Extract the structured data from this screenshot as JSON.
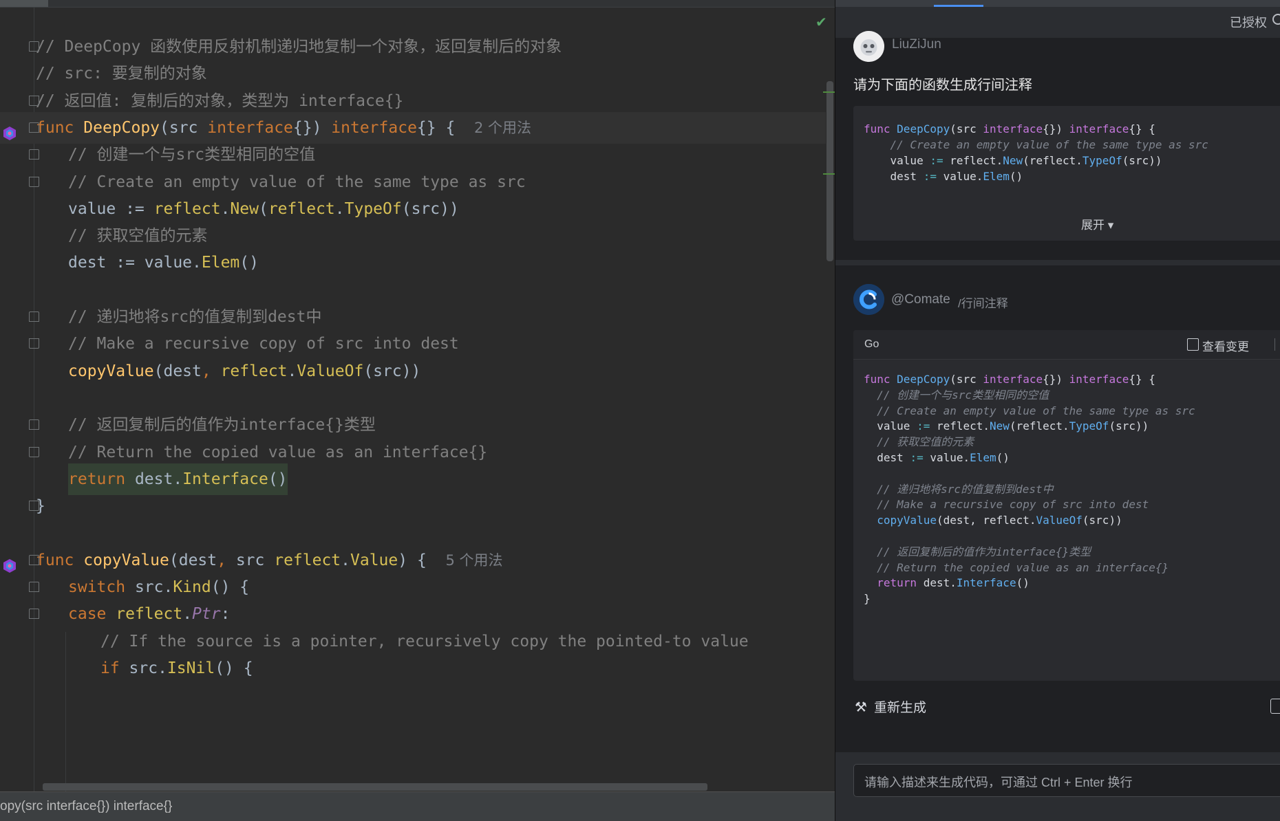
{
  "editor": {
    "usage_hints": [
      "2 个用法",
      "5 个用法"
    ],
    "lines": [
      {
        "parts": [
          [
            "c-cm",
            "// DeepCopy 函数使用反射机制递归地复制一个对象，返回复制后的对象"
          ]
        ]
      },
      {
        "parts": [
          [
            "c-cm",
            "// src: 要复制的对象"
          ]
        ]
      },
      {
        "parts": [
          [
            "c-cm",
            "// 返回值: 复制后的对象，类型为 interface{}"
          ]
        ]
      },
      {
        "parts": [
          [
            "c-kw",
            "func "
          ],
          [
            "c-fn",
            "DeepCopy"
          ],
          [
            "c-tx",
            "(src "
          ],
          [
            "c-kw",
            "interface"
          ],
          [
            "c-tx",
            "{}) "
          ],
          [
            "c-kw",
            "interface"
          ],
          [
            "c-tx",
            "{} {  "
          ]
        ],
        "hint": 0
      },
      {
        "parts": [
          [
            "c-cm",
            "// 创建一个与src类型相同的空值"
          ]
        ]
      },
      {
        "parts": [
          [
            "c-cm",
            "// Create an empty value of the same type as src"
          ]
        ]
      },
      {
        "parts": [
          [
            "c-tx",
            "value := "
          ],
          [
            "c-mt",
            "reflect"
          ],
          [
            "c-tx",
            "."
          ],
          [
            "c-mt",
            "New"
          ],
          [
            "c-tx",
            "("
          ],
          [
            "c-mt",
            "reflect"
          ],
          [
            "c-tx",
            "."
          ],
          [
            "c-mt",
            "TypeOf"
          ],
          [
            "c-tx",
            "(src))"
          ]
        ]
      },
      {
        "parts": [
          [
            "c-cm",
            "// 获取空值的元素"
          ]
        ]
      },
      {
        "parts": [
          [
            "c-tx",
            "dest := value."
          ],
          [
            "c-mt",
            "Elem"
          ],
          [
            "c-tx",
            "()"
          ]
        ]
      },
      {
        "parts": []
      },
      {
        "parts": [
          [
            "c-cm",
            "// 递归地将src的值复制到dest中"
          ]
        ]
      },
      {
        "parts": [
          [
            "c-cm",
            "// Make a recursive copy of src into dest"
          ]
        ]
      },
      {
        "parts": [
          [
            "c-fn",
            "copyValue"
          ],
          [
            "c-tx",
            "(dest"
          ],
          [
            "c-kw",
            ", "
          ],
          [
            "c-mt",
            "reflect"
          ],
          [
            "c-tx",
            "."
          ],
          [
            "c-mt",
            "ValueOf"
          ],
          [
            "c-tx",
            "(src))"
          ]
        ]
      },
      {
        "parts": []
      },
      {
        "parts": [
          [
            "c-cm",
            "// 返回复制后的值作为interface{}类型"
          ]
        ]
      },
      {
        "parts": [
          [
            "c-cm",
            "// Return the copied value as an interface{}"
          ]
        ]
      },
      {
        "parts": [
          [
            "c-kw",
            "return "
          ],
          [
            "c-tx",
            "dest."
          ],
          [
            "c-mt",
            "Interface"
          ],
          [
            "c-tx",
            "()"
          ]
        ]
      },
      {
        "parts": [
          [
            "c-tx",
            "}"
          ]
        ]
      },
      {
        "parts": []
      },
      {
        "parts": [
          [
            "c-kw",
            "func "
          ],
          [
            "c-fn",
            "copyValue"
          ],
          [
            "c-tx",
            "(dest"
          ],
          [
            "c-kw",
            ", "
          ],
          [
            "c-tx",
            "src "
          ],
          [
            "c-mt",
            "reflect"
          ],
          [
            "c-tx",
            "."
          ],
          [
            "c-mt",
            "Value"
          ],
          [
            "c-tx",
            ") {  "
          ]
        ],
        "hint": 1
      },
      {
        "parts": [
          [
            "c-kw",
            "switch "
          ],
          [
            "c-tx",
            "src."
          ],
          [
            "c-mt",
            "Kind"
          ],
          [
            "c-tx",
            "() {"
          ]
        ]
      },
      {
        "parts": [
          [
            "c-kw",
            "case "
          ],
          [
            "c-mt",
            "reflect"
          ],
          [
            "c-tx",
            "."
          ],
          [
            "c-pt",
            "Ptr"
          ],
          [
            "c-tx",
            ":"
          ]
        ]
      },
      {
        "parts": [
          [
            "c-cm",
            "// If the source is a pointer, recursively copy the pointed-to value"
          ]
        ]
      },
      {
        "parts": [
          [
            "c-kw",
            "if "
          ],
          [
            "c-tx",
            "src."
          ],
          [
            "c-mt",
            "IsNil"
          ],
          [
            "c-tx",
            "() {"
          ]
        ]
      }
    ],
    "status_text": "opy(src interface{}) interface{}"
  },
  "panel": {
    "auth_label": "已授权",
    "user_name": "LiuZiJun",
    "user_prompt": "请为下面的函数生成行间注释",
    "preview_lines": [
      [
        [
          "p-kw",
          "func "
        ],
        [
          "p-fn",
          "DeepCopy"
        ],
        [
          "p-tx",
          "(src "
        ],
        [
          "p-ty",
          "interface"
        ],
        [
          "p-tx",
          "{}) "
        ],
        [
          "p-ty",
          "interface"
        ],
        [
          "p-tx",
          "{} {"
        ]
      ],
      [
        [
          "p-cm",
          "    // Create an empty value of the same type as src"
        ]
      ],
      [
        [
          "p-tx",
          "    value "
        ],
        [
          "p-op",
          ":="
        ],
        [
          "p-tx",
          " reflect."
        ],
        [
          "p-call",
          "New"
        ],
        [
          "p-tx",
          "(reflect."
        ],
        [
          "p-call",
          "TypeOf"
        ],
        [
          "p-tx",
          "(src))"
        ]
      ],
      [
        [
          "p-tx",
          "    dest "
        ],
        [
          "p-op",
          ":="
        ],
        [
          "p-tx",
          " value."
        ],
        [
          "p-call",
          "Elem"
        ],
        [
          "p-tx",
          "()"
        ]
      ]
    ],
    "expand_label": "展开 ▾",
    "bot_name": "@Comate",
    "bot_command": "/行间注释",
    "answer_lang": "Go",
    "view_change_label": "查看变更",
    "answer_lines": [
      [
        [
          "p-kw",
          "func "
        ],
        [
          "p-fn",
          "DeepCopy"
        ],
        [
          "p-tx",
          "(src "
        ],
        [
          "p-ty",
          "interface"
        ],
        [
          "p-tx",
          "{}) "
        ],
        [
          "p-ty",
          "interface"
        ],
        [
          "p-tx",
          "{} {"
        ]
      ],
      [
        [
          "p-cm",
          "  // 创建一个与src类型相同的空值"
        ]
      ],
      [
        [
          "p-cm",
          "  // Create an empty value of the same type as src"
        ]
      ],
      [
        [
          "p-tx",
          "  value "
        ],
        [
          "p-op",
          ":="
        ],
        [
          "p-tx",
          " reflect."
        ],
        [
          "p-call",
          "New"
        ],
        [
          "p-tx",
          "(reflect."
        ],
        [
          "p-call",
          "TypeOf"
        ],
        [
          "p-tx",
          "(src))"
        ]
      ],
      [
        [
          "p-cm",
          "  // 获取空值的元素"
        ]
      ],
      [
        [
          "p-tx",
          "  dest "
        ],
        [
          "p-op",
          ":="
        ],
        [
          "p-tx",
          " value."
        ],
        [
          "p-call",
          "Elem"
        ],
        [
          "p-tx",
          "()"
        ]
      ],
      [],
      [
        [
          "p-cm",
          "  // 递归地将src的值复制到dest中"
        ]
      ],
      [
        [
          "p-cm",
          "  // Make a recursive copy of src into dest"
        ]
      ],
      [
        [
          "p-tx",
          "  "
        ],
        [
          "p-call",
          "copyValue"
        ],
        [
          "p-tx",
          "(dest, reflect."
        ],
        [
          "p-call",
          "ValueOf"
        ],
        [
          "p-tx",
          "(src))"
        ]
      ],
      [],
      [
        [
          "p-cm",
          "  // 返回复制后的值作为interface{}类型"
        ]
      ],
      [
        [
          "p-cm",
          "  // Return the copied value as an interface{}"
        ]
      ],
      [
        [
          "p-tx",
          "  "
        ],
        [
          "p-kw",
          "return "
        ],
        [
          "p-tx",
          "dest."
        ],
        [
          "p-call",
          "Interface"
        ],
        [
          "p-tx",
          "()"
        ]
      ],
      [
        [
          "p-tx",
          "}"
        ]
      ]
    ],
    "regenerate_label": "重新生成",
    "input_placeholder": "请输入描述来生成代码，可通过 Ctrl + Enter 换行"
  }
}
